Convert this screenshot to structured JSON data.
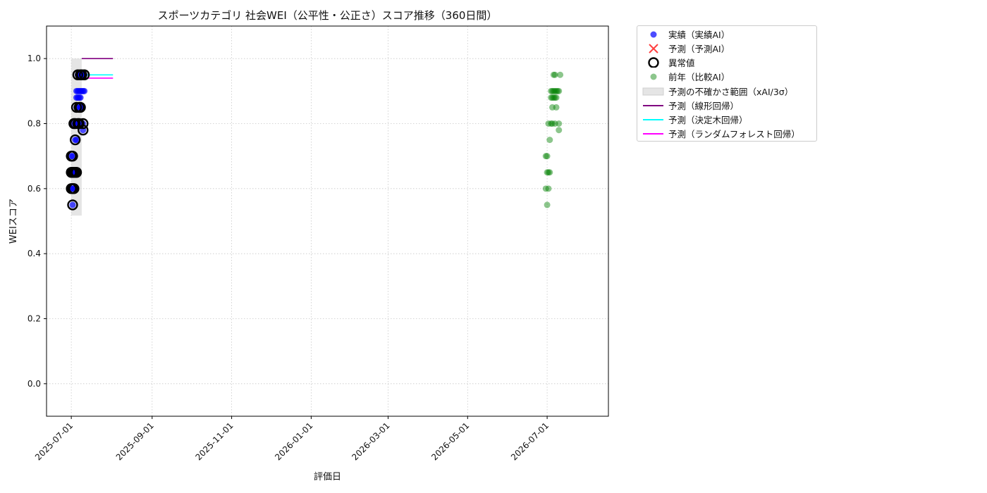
{
  "chart_data": {
    "type": "scatter",
    "title": "スポーツカテゴリ 社会WEI（公平性・公正さ）スコア推移（360日間）",
    "xlabel": "評価日",
    "ylabel": "WEIスコア",
    "xlim": [
      "2025-06-12",
      "2026-08-17"
    ],
    "ylim": [
      -0.1,
      1.1
    ],
    "x_ticks": [
      "2025-07-01",
      "2025-09-01",
      "2025-11-01",
      "2026-01-01",
      "2026-03-01",
      "2026-05-01",
      "2026-07-01"
    ],
    "y_ticks": [
      0.0,
      0.2,
      0.4,
      0.6,
      0.8,
      1.0
    ],
    "y_tick_labels": [
      "0.0",
      "0.2",
      "0.4",
      "0.6",
      "0.8",
      "1.0"
    ],
    "grid": true,
    "legend_position": "outside-top-right",
    "series": [
      {
        "name": "実績（実績AI）",
        "kind": "scatter",
        "color": "#0000ff",
        "points": [
          {
            "x": "2025-07-01",
            "y": 0.6
          },
          {
            "x": "2025-07-01",
            "y": 0.65
          },
          {
            "x": "2025-07-01",
            "y": 0.7
          },
          {
            "x": "2025-07-02",
            "y": 0.55
          },
          {
            "x": "2025-07-02",
            "y": 0.6
          },
          {
            "x": "2025-07-02",
            "y": 0.65
          },
          {
            "x": "2025-07-02",
            "y": 0.7
          },
          {
            "x": "2025-07-03",
            "y": 0.6
          },
          {
            "x": "2025-07-03",
            "y": 0.65
          },
          {
            "x": "2025-07-03",
            "y": 0.8
          },
          {
            "x": "2025-07-04",
            "y": 0.65
          },
          {
            "x": "2025-07-04",
            "y": 0.75
          },
          {
            "x": "2025-07-04",
            "y": 0.8
          },
          {
            "x": "2025-07-05",
            "y": 0.65
          },
          {
            "x": "2025-07-05",
            "y": 0.75
          },
          {
            "x": "2025-07-05",
            "y": 0.85
          },
          {
            "x": "2025-07-05",
            "y": 0.88
          },
          {
            "x": "2025-07-05",
            "y": 0.9
          },
          {
            "x": "2025-07-06",
            "y": 0.8
          },
          {
            "x": "2025-07-06",
            "y": 0.88
          },
          {
            "x": "2025-07-06",
            "y": 0.9
          },
          {
            "x": "2025-07-06",
            "y": 0.95
          },
          {
            "x": "2025-07-07",
            "y": 0.8
          },
          {
            "x": "2025-07-07",
            "y": 0.85
          },
          {
            "x": "2025-07-07",
            "y": 0.88
          },
          {
            "x": "2025-07-07",
            "y": 0.9
          },
          {
            "x": "2025-07-07",
            "y": 0.95
          },
          {
            "x": "2025-07-08",
            "y": 0.85
          },
          {
            "x": "2025-07-08",
            "y": 0.88
          },
          {
            "x": "2025-07-08",
            "y": 0.9
          },
          {
            "x": "2025-07-08",
            "y": 0.95
          },
          {
            "x": "2025-07-09",
            "y": 0.85
          },
          {
            "x": "2025-07-09",
            "y": 0.9
          },
          {
            "x": "2025-07-09",
            "y": 0.95
          },
          {
            "x": "2025-07-10",
            "y": 0.78
          },
          {
            "x": "2025-07-10",
            "y": 0.8
          },
          {
            "x": "2025-07-10",
            "y": 0.9
          },
          {
            "x": "2025-07-10",
            "y": 0.95
          },
          {
            "x": "2025-07-11",
            "y": 0.9
          },
          {
            "x": "2025-07-11",
            "y": 0.95
          }
        ]
      },
      {
        "name": "予測（予測AI）",
        "kind": "scatter",
        "color": "#ff0000",
        "points": []
      },
      {
        "name": "異常値",
        "kind": "ring",
        "color": "#000000",
        "points": [
          {
            "x": "2025-07-01",
            "y": 0.6
          },
          {
            "x": "2025-07-01",
            "y": 0.65
          },
          {
            "x": "2025-07-01",
            "y": 0.7
          },
          {
            "x": "2025-07-02",
            "y": 0.55
          },
          {
            "x": "2025-07-02",
            "y": 0.6
          },
          {
            "x": "2025-07-02",
            "y": 0.65
          },
          {
            "x": "2025-07-02",
            "y": 0.7
          },
          {
            "x": "2025-07-03",
            "y": 0.6
          },
          {
            "x": "2025-07-03",
            "y": 0.65
          },
          {
            "x": "2025-07-03",
            "y": 0.8
          },
          {
            "x": "2025-07-04",
            "y": 0.65
          },
          {
            "x": "2025-07-04",
            "y": 0.75
          },
          {
            "x": "2025-07-04",
            "y": 0.8
          },
          {
            "x": "2025-07-05",
            "y": 0.65
          },
          {
            "x": "2025-07-05",
            "y": 0.85
          },
          {
            "x": "2025-07-06",
            "y": 0.8
          },
          {
            "x": "2025-07-06",
            "y": 0.95
          },
          {
            "x": "2025-07-07",
            "y": 0.8
          },
          {
            "x": "2025-07-07",
            "y": 0.85
          },
          {
            "x": "2025-07-08",
            "y": 0.85
          },
          {
            "x": "2025-07-08",
            "y": 0.95
          },
          {
            "x": "2025-07-09",
            "y": 0.95
          },
          {
            "x": "2025-07-10",
            "y": 0.78
          },
          {
            "x": "2025-07-10",
            "y": 0.8
          },
          {
            "x": "2025-07-11",
            "y": 0.95
          }
        ]
      },
      {
        "name": "前年（比較AI）",
        "kind": "scatter",
        "color": "#008000",
        "points": [
          {
            "x": "2026-06-30",
            "y": 0.6
          },
          {
            "x": "2026-06-30",
            "y": 0.7
          },
          {
            "x": "2026-07-01",
            "y": 0.55
          },
          {
            "x": "2026-07-01",
            "y": 0.65
          },
          {
            "x": "2026-07-01",
            "y": 0.7
          },
          {
            "x": "2026-07-02",
            "y": 0.6
          },
          {
            "x": "2026-07-02",
            "y": 0.65
          },
          {
            "x": "2026-07-02",
            "y": 0.8
          },
          {
            "x": "2026-07-03",
            "y": 0.65
          },
          {
            "x": "2026-07-03",
            "y": 0.75
          },
          {
            "x": "2026-07-04",
            "y": 0.8
          },
          {
            "x": "2026-07-04",
            "y": 0.88
          },
          {
            "x": "2026-07-04",
            "y": 0.9
          },
          {
            "x": "2026-07-05",
            "y": 0.8
          },
          {
            "x": "2026-07-05",
            "y": 0.85
          },
          {
            "x": "2026-07-05",
            "y": 0.88
          },
          {
            "x": "2026-07-05",
            "y": 0.9
          },
          {
            "x": "2026-07-06",
            "y": 0.88
          },
          {
            "x": "2026-07-06",
            "y": 0.9
          },
          {
            "x": "2026-07-06",
            "y": 0.95
          },
          {
            "x": "2026-07-07",
            "y": 0.8
          },
          {
            "x": "2026-07-07",
            "y": 0.88
          },
          {
            "x": "2026-07-07",
            "y": 0.9
          },
          {
            "x": "2026-07-07",
            "y": 0.95
          },
          {
            "x": "2026-07-08",
            "y": 0.85
          },
          {
            "x": "2026-07-08",
            "y": 0.88
          },
          {
            "x": "2026-07-08",
            "y": 0.9
          },
          {
            "x": "2026-07-09",
            "y": 0.9
          },
          {
            "x": "2026-07-10",
            "y": 0.78
          },
          {
            "x": "2026-07-10",
            "y": 0.8
          },
          {
            "x": "2026-07-10",
            "y": 0.9
          },
          {
            "x": "2026-07-11",
            "y": 0.95
          }
        ]
      },
      {
        "name": "予測の不確かさ範囲（xAI/3σ）",
        "kind": "band",
        "color": "#d3d3d3",
        "x": [
          "2025-07-01",
          "2025-07-09"
        ],
        "y_low": 0.517,
        "y_high": 1.0
      },
      {
        "name": "予測（線形回帰）",
        "kind": "line",
        "color": "#800080",
        "points": [
          {
            "x": "2025-07-09",
            "y": 1.0
          },
          {
            "x": "2025-08-02",
            "y": 1.0
          }
        ]
      },
      {
        "name": "予測（決定木回帰）",
        "kind": "line",
        "color": "#00ffff",
        "points": [
          {
            "x": "2025-07-09",
            "y": 0.95
          },
          {
            "x": "2025-08-02",
            "y": 0.95
          }
        ]
      },
      {
        "name": "予測（ランダムフォレスト回帰）",
        "kind": "line",
        "color": "#ff00ff",
        "points": [
          {
            "x": "2025-07-09",
            "y": 0.94
          },
          {
            "x": "2025-08-02",
            "y": 0.94
          }
        ]
      }
    ]
  }
}
